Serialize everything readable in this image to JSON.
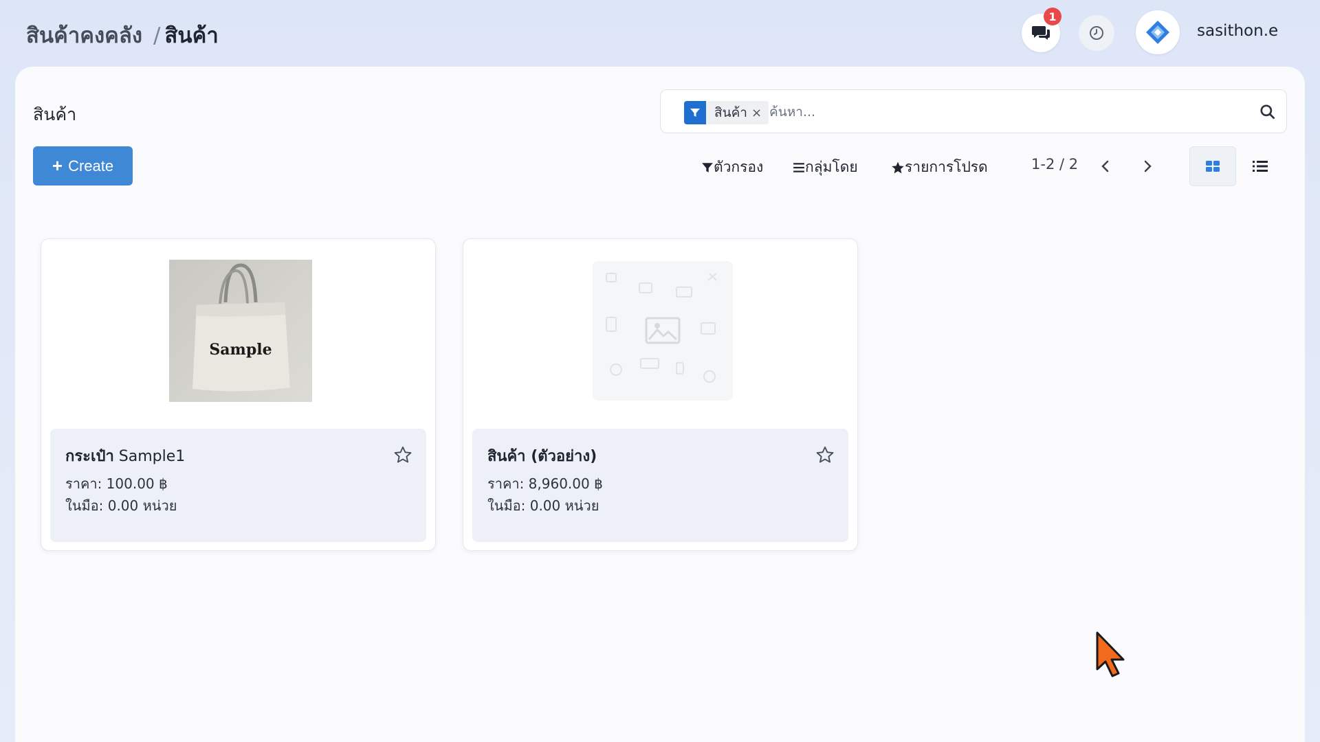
{
  "breadcrumb": {
    "parent": "สินค้าคงคลัง",
    "separator": "/",
    "current": "สินค้า"
  },
  "header": {
    "notification_count": "1",
    "username": "sasithon.e"
  },
  "page": {
    "title": "สินค้า"
  },
  "search": {
    "facet_label": "สินค้า",
    "facet_remove": "×",
    "placeholder": "ค้นหา..."
  },
  "toolbar": {
    "create_label": "Create",
    "filters_label": "ตัวกรอง",
    "group_by_label": "กลุ่มโดย",
    "favorites_label": "รายการโปรด",
    "pager": "1-2 / 2"
  },
  "products": [
    {
      "name": "กระเป๋า",
      "name_suffix": " Sample1",
      "price": "ราคา: 100.00 ฿",
      "on_hand": "ในมือ: 0.00 หน่วย",
      "image_text": "Sample"
    },
    {
      "name": "สินค้า (ตัวอย่าง)",
      "name_suffix": "",
      "price": "ราคา: 8,960.00 ฿",
      "on_hand": "ในมือ: 0.00 หน่วย"
    }
  ],
  "colors": {
    "primary": "#3f88d6",
    "facet": "#1e6fd0",
    "badge": "#e8484a",
    "cursor": "#f26a1b"
  }
}
